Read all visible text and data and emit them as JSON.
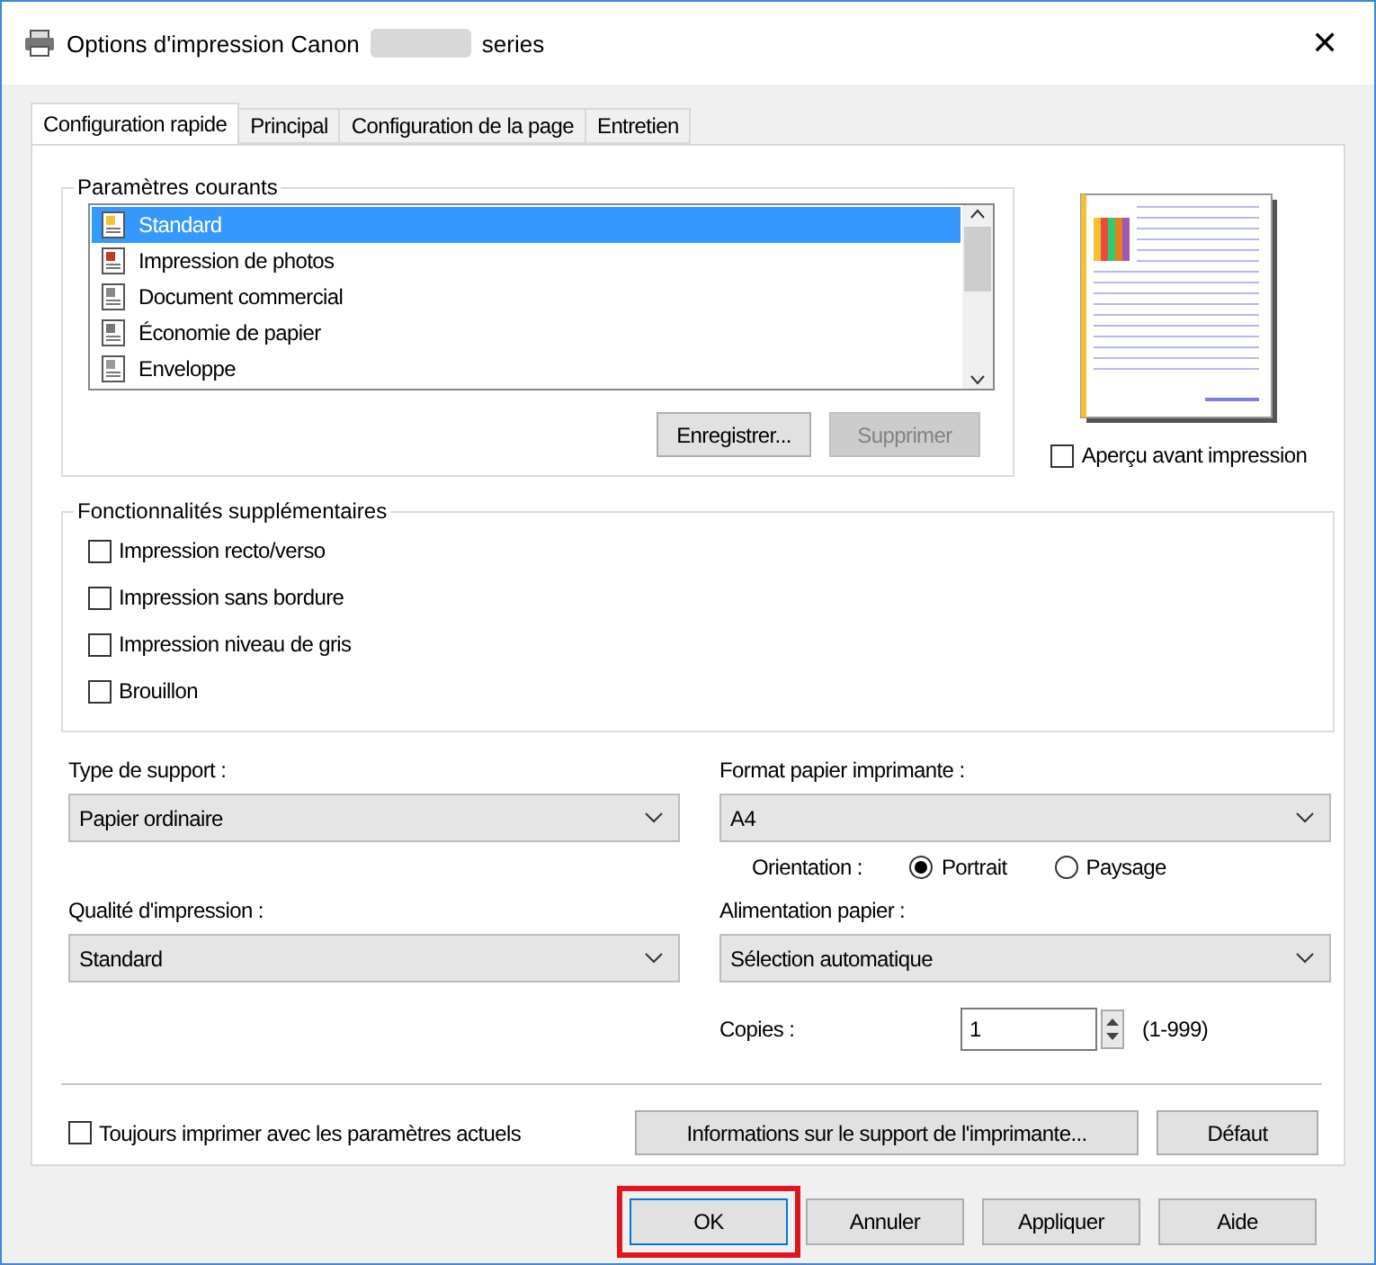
{
  "window": {
    "title_prefix": "Options d'impression Canon",
    "title_suffix": "series",
    "close": "✕"
  },
  "tabs": [
    {
      "label": "Configuration rapide",
      "selected": true
    },
    {
      "label": "Principal",
      "selected": false
    },
    {
      "label": "Configuration de la page",
      "selected": false
    },
    {
      "label": "Entretien",
      "selected": false
    }
  ],
  "current_settings": {
    "title": "Paramètres courants",
    "items": [
      {
        "label": "Standard",
        "selected": true
      },
      {
        "label": "Impression de photos",
        "selected": false
      },
      {
        "label": "Document commercial",
        "selected": false
      },
      {
        "label": "Économie de papier",
        "selected": false
      },
      {
        "label": "Enveloppe",
        "selected": false
      }
    ],
    "buttons": [
      {
        "label": "Enregistrer...",
        "disabled": false
      },
      {
        "label": "Supprimer",
        "disabled": true
      }
    ]
  },
  "preview": {
    "label": "Aperçu avant impression",
    "checked": false
  },
  "features": {
    "title": "Fonctionnalités supplémentaires",
    "items": [
      {
        "label": "Impression recto/verso",
        "checked": false
      },
      {
        "label": "Impression sans bordure",
        "checked": false
      },
      {
        "label": "Impression niveau de gris",
        "checked": false
      },
      {
        "label": "Brouillon",
        "checked": false
      }
    ]
  },
  "media_type": {
    "label": "Type de support :",
    "value": "Papier ordinaire"
  },
  "paper_size": {
    "label": "Format papier imprimante :",
    "value": "A4"
  },
  "orientation": {
    "label": "Orientation :",
    "options": [
      {
        "label": "Portrait",
        "selected": true
      },
      {
        "label": "Paysage",
        "selected": false
      }
    ]
  },
  "print_quality": {
    "label": "Qualité d'impression :",
    "value": "Standard"
  },
  "paper_source": {
    "label": "Alimentation papier :",
    "value": "Sélection automatique"
  },
  "copies": {
    "label": "Copies :",
    "value": "1",
    "range": "(1-999)"
  },
  "always_print": {
    "label": "Toujours imprimer avec les paramètres actuels",
    "checked": false
  },
  "panel_buttons": [
    "Informations sur le support de l'imprimante...",
    "Défaut"
  ],
  "dialog_buttons": [
    {
      "label": "OK",
      "highlighted": true
    },
    {
      "label": "Annuler",
      "highlighted": false
    },
    {
      "label": "Appliquer",
      "highlighted": false
    },
    {
      "label": "Aide",
      "highlighted": false
    }
  ]
}
